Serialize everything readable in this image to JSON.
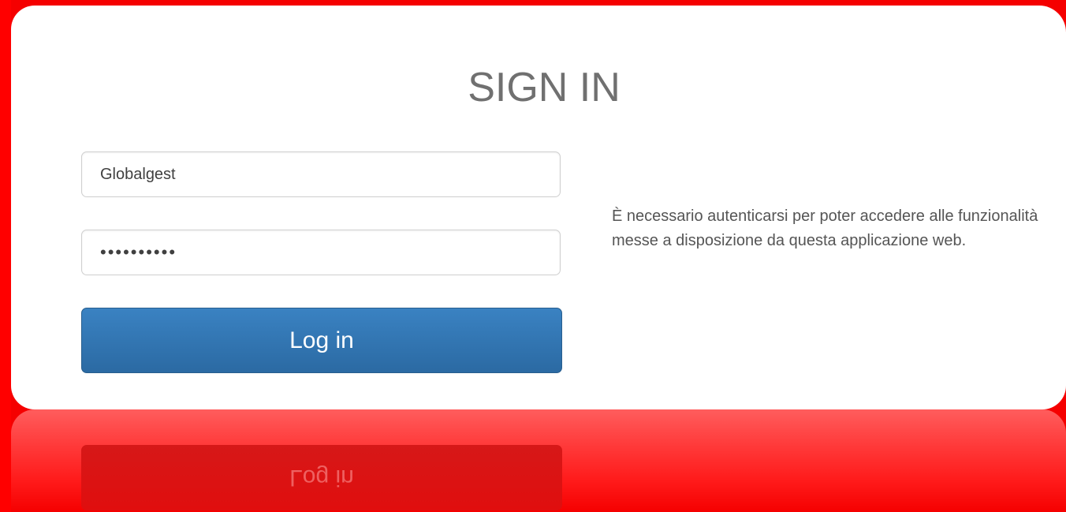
{
  "login": {
    "title": "SIGN IN",
    "username_value": "Globalgest",
    "password_value": "••••••••••",
    "login_button": "Log in",
    "info_text": "È necessario autenticarsi per poter accedere alle funzionalità messe a disposizione da questa applicazione web."
  },
  "reflection": {
    "button_text": "Log in"
  },
  "colors": {
    "background": "#ff0000",
    "card": "#ffffff",
    "button": "#337ab7",
    "title": "#707070"
  }
}
